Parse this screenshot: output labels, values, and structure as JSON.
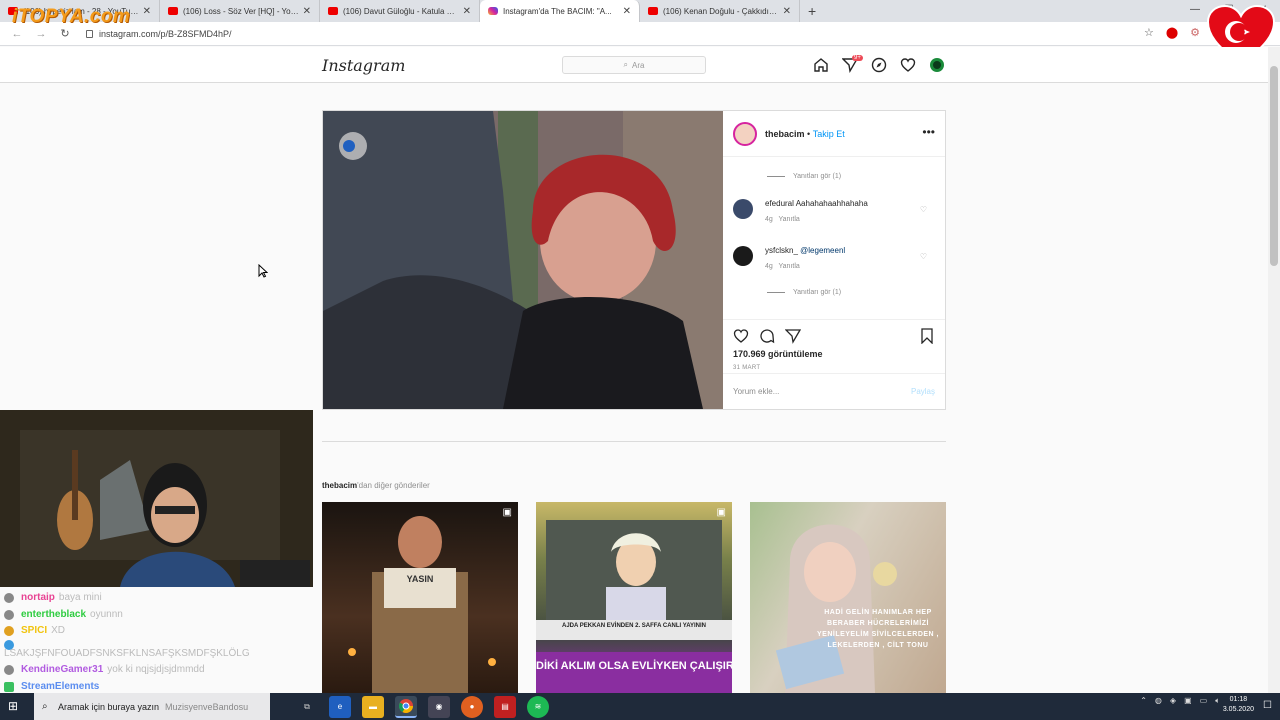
{
  "browser": {
    "tabs": [
      {
        "title": "(106) hyperiz lam - 28 - YouTube",
        "icon": "youtube-icon",
        "active": false
      },
      {
        "title": "(106) Loss - Söz Ver [HQ] - YouTube",
        "icon": "youtube-icon",
        "active": false
      },
      {
        "title": "(106) Davut Güloğlu - Katula Katula",
        "icon": "youtube-icon",
        "active": false
      },
      {
        "title": "Instagram'da The BACIM: \"A...",
        "icon": "instagram-icon",
        "active": true
      },
      {
        "title": "(106) Kenan Doğulu - Çakkıdı - Yo",
        "icon": "youtube-icon",
        "active": false
      }
    ],
    "url": "instagram.com/p/B-Z8SFMD4hP/",
    "overlay_logo": "iTOPYA.com"
  },
  "instagram": {
    "brand": "Instagram",
    "search_placeholder": "Ara",
    "notification_count": "9+",
    "post": {
      "username": "thebacim",
      "separator": "•",
      "follow": "Takip Et",
      "comments": [
        {
          "type": "replies",
          "text": "Yanıtları gör (1)"
        },
        {
          "user": "efedural",
          "text": "Aahahahaahhahaha",
          "time": "4g",
          "reply": "Yanıtla"
        },
        {
          "user": "ysfclskn_",
          "text": "@legemeenl",
          "time": "4g",
          "reply": "Yanıtla"
        },
        {
          "type": "replies",
          "text": "Yanıtları gör (1)"
        }
      ],
      "views": "170.969 görüntüleme",
      "date": "31 MART",
      "comment_placeholder": "Yorum ekle...",
      "share_label": "Paylaş"
    },
    "more_posts": {
      "user": "thebacim",
      "suffix": "'dan diğer gönderiler",
      "thumbs": [
        {
          "caption": "YASIN"
        },
        {
          "caption": "AJDA PEKKAN EVİNDEN 2. SAFFA CANLI YAYININ",
          "caption2": "DİKİ AKLIM OLSA EVLİYKEN ÇALIŞIR"
        },
        {
          "caption": "HADİ GELİN HANIMLAR HEP BERABER HÜCRELERİMİZİ YENİLEYELİM SİVİLCELERDEN , LEKELERDEN , CİLT TONU"
        }
      ]
    }
  },
  "chat": [
    {
      "name": "nortaip",
      "msg": "baya mini",
      "color": "#e84393"
    },
    {
      "name": "entertheblack",
      "msg": "oyunnn",
      "color": "#2ecc40"
    },
    {
      "name": "SPICI",
      "msg": "XD",
      "color": "#f1c40f"
    },
    {
      "name": "",
      "msg": "LSAKJŞFNFOUADFSNKSFKLNSAFŞKSMDFŞKLÖLG",
      "color": "#8fd14f"
    },
    {
      "name": "KendineGamer31",
      "msg": "yok ki nqjsjdjsjdmmdd",
      "color": "#b15be0"
    },
    {
      "name": "StreamElements",
      "msg": "",
      "color": "#5b8def"
    }
  ],
  "taskbar": {
    "search_placeholder": "Aramak için buraya yazın",
    "scroll_text": "MuzisyenveBandosu",
    "time": "01:18",
    "date": "3.05.2020"
  },
  "colors": {
    "ig_blue": "#0095f6",
    "notification_red": "#ed4956"
  }
}
